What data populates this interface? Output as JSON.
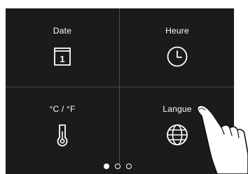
{
  "tiles": [
    {
      "label": "Date",
      "icon": "calendar-icon",
      "icon_text": "1"
    },
    {
      "label": "Heure",
      "icon": "clock-icon"
    },
    {
      "label": "°C / °F",
      "icon": "thermometer-icon"
    },
    {
      "label": "Langue",
      "icon": "globe-icon"
    }
  ],
  "pagination": {
    "pages": 3,
    "current": 1
  },
  "colors": {
    "background": "#1b1b1b",
    "divider": "#4a4a4a",
    "foreground": "#ffffff"
  }
}
